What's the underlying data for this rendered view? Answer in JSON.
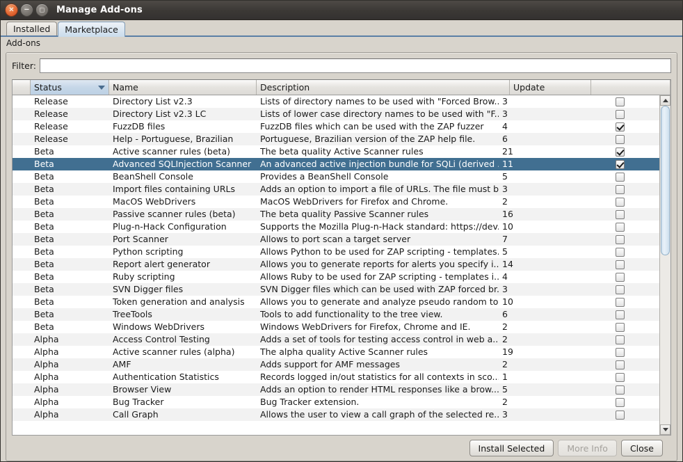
{
  "window": {
    "title": "Manage Add-ons",
    "controls": {
      "close": "×",
      "minimize": "−",
      "maximize": "□"
    }
  },
  "tabs": [
    {
      "label": "Installed",
      "active": false
    },
    {
      "label": "Marketplace",
      "active": true
    }
  ],
  "panel": {
    "label": "Add-ons"
  },
  "filter": {
    "label": "Filter:",
    "value": "",
    "placeholder": ""
  },
  "table": {
    "columns": [
      "Status",
      "Name",
      "Description",
      "Update",
      ""
    ],
    "sorted_column": "Status",
    "sort_direction": "descending",
    "rows": [
      {
        "status": "Release",
        "name": "Directory List v2.3",
        "description": "Lists of directory names to be used with \"Forced Brow...",
        "update": "3",
        "checked": false,
        "selected": false
      },
      {
        "status": "Release",
        "name": "Directory List v2.3 LC",
        "description": "Lists of lower case directory names to be used with \"F...",
        "update": "3",
        "checked": false,
        "selected": false
      },
      {
        "status": "Release",
        "name": "FuzzDB files",
        "description": "FuzzDB files which can be used with the ZAP fuzzer",
        "update": "4",
        "checked": true,
        "selected": false
      },
      {
        "status": "Release",
        "name": "Help - Portuguese, Brazilian",
        "description": "Portuguese, Brazilian version of the ZAP help file.",
        "update": "6",
        "checked": false,
        "selected": false
      },
      {
        "status": "Beta",
        "name": "Active scanner rules (beta)",
        "description": "The beta quality Active Scanner rules",
        "update": "21",
        "checked": true,
        "selected": false
      },
      {
        "status": "Beta",
        "name": "Advanced SQLInjection Scanner",
        "description": "An advanced active injection bundle for SQLi (derived ...",
        "update": "11",
        "checked": true,
        "selected": true
      },
      {
        "status": "Beta",
        "name": "BeanShell Console",
        "description": "Provides a BeanShell Console",
        "update": "5",
        "checked": false,
        "selected": false
      },
      {
        "status": "Beta",
        "name": "Import files containing URLs",
        "description": "Adds an option to import a file of URLs. The file must b...",
        "update": "3",
        "checked": false,
        "selected": false
      },
      {
        "status": "Beta",
        "name": "MacOS WebDrivers",
        "description": "MacOS WebDrivers for Firefox and Chrome.",
        "update": "2",
        "checked": false,
        "selected": false
      },
      {
        "status": "Beta",
        "name": "Passive scanner rules (beta)",
        "description": "The beta quality Passive Scanner rules",
        "update": "16",
        "checked": false,
        "selected": false
      },
      {
        "status": "Beta",
        "name": "Plug-n-Hack Configuration",
        "description": "Supports the Mozilla Plug-n-Hack standard: https://dev...",
        "update": "10",
        "checked": false,
        "selected": false
      },
      {
        "status": "Beta",
        "name": "Port Scanner",
        "description": "Allows to port scan a target server",
        "update": "7",
        "checked": false,
        "selected": false
      },
      {
        "status": "Beta",
        "name": "Python scripting",
        "description": "Allows Python to be used for ZAP scripting - templates...",
        "update": "5",
        "checked": false,
        "selected": false
      },
      {
        "status": "Beta",
        "name": "Report alert generator",
        "description": "Allows you to generate reports for alerts you specify i...",
        "update": "14",
        "checked": false,
        "selected": false
      },
      {
        "status": "Beta",
        "name": "Ruby scripting",
        "description": "Allows Ruby to be used for ZAP scripting - templates i...",
        "update": "4",
        "checked": false,
        "selected": false
      },
      {
        "status": "Beta",
        "name": "SVN Digger files",
        "description": "SVN Digger files which can be used with ZAP forced br...",
        "update": "3",
        "checked": false,
        "selected": false
      },
      {
        "status": "Beta",
        "name": "Token generation and analysis",
        "description": "Allows you to generate and analyze pseudo random to...",
        "update": "10",
        "checked": false,
        "selected": false
      },
      {
        "status": "Beta",
        "name": "TreeTools",
        "description": "Tools to add functionality to the tree view.",
        "update": "6",
        "checked": false,
        "selected": false
      },
      {
        "status": "Beta",
        "name": "Windows WebDrivers",
        "description": "Windows WebDrivers for Firefox, Chrome and IE.",
        "update": "2",
        "checked": false,
        "selected": false
      },
      {
        "status": "Alpha",
        "name": "Access Control Testing",
        "description": "Adds a set of tools for testing access control in web a...",
        "update": "2",
        "checked": false,
        "selected": false
      },
      {
        "status": "Alpha",
        "name": "Active scanner rules (alpha)",
        "description": "The alpha quality Active Scanner rules",
        "update": "19",
        "checked": false,
        "selected": false
      },
      {
        "status": "Alpha",
        "name": "AMF",
        "description": "Adds support for AMF messages",
        "update": "2",
        "checked": false,
        "selected": false
      },
      {
        "status": "Alpha",
        "name": "Authentication Statistics",
        "description": "Records logged in/out statistics for all contexts in sco...",
        "update": "1",
        "checked": false,
        "selected": false
      },
      {
        "status": "Alpha",
        "name": "Browser View",
        "description": "Adds an option to render HTML responses like a brow...",
        "update": "5",
        "checked": false,
        "selected": false
      },
      {
        "status": "Alpha",
        "name": "Bug Tracker",
        "description": "Bug Tracker extension.",
        "update": "2",
        "checked": false,
        "selected": false
      },
      {
        "status": "Alpha",
        "name": "Call Graph",
        "description": "Allows the user to view a call graph of the selected re...",
        "update": "3",
        "checked": false,
        "selected": false
      }
    ]
  },
  "scrollbar": {
    "thumb_top_percent": 0,
    "thumb_height_percent": 47
  },
  "buttons": [
    {
      "label": "Install Selected",
      "disabled": false
    },
    {
      "label": "More Info",
      "disabled": true
    },
    {
      "label": "Close",
      "disabled": false
    }
  ],
  "colors": {
    "selection": "#416f91",
    "sorted_header": "#c6d7e8",
    "titlebar": "#3b3835",
    "close_button": "#e8703a"
  }
}
